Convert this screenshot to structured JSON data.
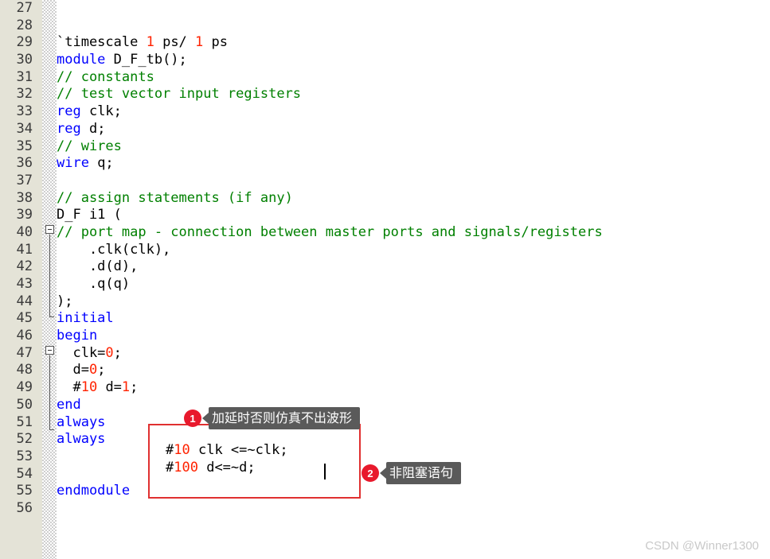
{
  "editor": {
    "first_line_number": 27,
    "language": "verilog",
    "lines": [
      {
        "n": 27,
        "tokens": []
      },
      {
        "n": 28,
        "tokens": []
      },
      {
        "n": 29,
        "tokens": [
          {
            "t": "`timescale ",
            "c": "pl"
          },
          {
            "t": "1",
            "c": "num"
          },
          {
            "t": " ps/ ",
            "c": "pl"
          },
          {
            "t": "1",
            "c": "num"
          },
          {
            "t": " ps",
            "c": "pl"
          }
        ]
      },
      {
        "n": 30,
        "tokens": [
          {
            "t": "module",
            "c": "kw"
          },
          {
            "t": " D_F_tb();",
            "c": "pl"
          }
        ]
      },
      {
        "n": 31,
        "tokens": [
          {
            "t": "// constants",
            "c": "cm"
          }
        ]
      },
      {
        "n": 32,
        "tokens": [
          {
            "t": "// test vector input registers",
            "c": "cm"
          }
        ]
      },
      {
        "n": 33,
        "tokens": [
          {
            "t": "reg",
            "c": "kw"
          },
          {
            "t": " clk;",
            "c": "pl"
          }
        ]
      },
      {
        "n": 34,
        "tokens": [
          {
            "t": "reg",
            "c": "kw"
          },
          {
            "t": " d;",
            "c": "pl"
          }
        ]
      },
      {
        "n": 35,
        "tokens": [
          {
            "t": "// wires",
            "c": "cm"
          }
        ]
      },
      {
        "n": 36,
        "tokens": [
          {
            "t": "wire",
            "c": "kw"
          },
          {
            "t": " q;",
            "c": "pl"
          }
        ]
      },
      {
        "n": 37,
        "tokens": []
      },
      {
        "n": 38,
        "tokens": [
          {
            "t": "// assign statements (if any)",
            "c": "cm"
          }
        ]
      },
      {
        "n": 39,
        "tokens": [
          {
            "t": "D_F i1 (",
            "c": "pl"
          }
        ]
      },
      {
        "n": 40,
        "tokens": [
          {
            "t": "// port map - connection between master ports and signals/registers",
            "c": "cm"
          }
        ]
      },
      {
        "n": 41,
        "tokens": [
          {
            "t": "    .clk(clk),",
            "c": "pl"
          }
        ]
      },
      {
        "n": 42,
        "tokens": [
          {
            "t": "    .d(d),",
            "c": "pl"
          }
        ]
      },
      {
        "n": 43,
        "tokens": [
          {
            "t": "    .q(q)",
            "c": "pl"
          }
        ]
      },
      {
        "n": 44,
        "tokens": [
          {
            "t": ");",
            "c": "pl"
          }
        ]
      },
      {
        "n": 45,
        "tokens": [
          {
            "t": "initial",
            "c": "kw"
          }
        ]
      },
      {
        "n": 46,
        "tokens": [
          {
            "t": "begin",
            "c": "kw"
          }
        ]
      },
      {
        "n": 47,
        "tokens": [
          {
            "t": "  clk=",
            "c": "pl"
          },
          {
            "t": "0",
            "c": "num"
          },
          {
            "t": ";",
            "c": "pl"
          }
        ]
      },
      {
        "n": 48,
        "tokens": [
          {
            "t": "  d=",
            "c": "pl"
          },
          {
            "t": "0",
            "c": "num"
          },
          {
            "t": ";",
            "c": "pl"
          }
        ]
      },
      {
        "n": 49,
        "tokens": [
          {
            "t": "  #",
            "c": "pl"
          },
          {
            "t": "10",
            "c": "num"
          },
          {
            "t": " d=",
            "c": "pl"
          },
          {
            "t": "1",
            "c": "num"
          },
          {
            "t": ";",
            "c": "pl"
          }
        ]
      },
      {
        "n": 50,
        "tokens": [
          {
            "t": "end",
            "c": "kw"
          }
        ]
      },
      {
        "n": 51,
        "tokens": [
          {
            "t": "always",
            "c": "kw"
          }
        ]
      },
      {
        "n": 52,
        "tokens": [
          {
            "t": "always",
            "c": "kw"
          }
        ]
      },
      {
        "n": 53,
        "tokens": []
      },
      {
        "n": 54,
        "tokens": []
      },
      {
        "n": 55,
        "tokens": [
          {
            "t": "endmodule",
            "c": "kw"
          }
        ]
      },
      {
        "n": 56,
        "tokens": []
      }
    ],
    "overlay_lines": [
      {
        "tokens": [
          {
            "t": "#",
            "c": "pl"
          },
          {
            "t": "10",
            "c": "num"
          },
          {
            "t": " clk <=~clk;",
            "c": "pl"
          }
        ]
      },
      {
        "tokens": [
          {
            "t": "#",
            "c": "pl"
          },
          {
            "t": "100",
            "c": "num"
          },
          {
            "t": " d<=~d;",
            "c": "pl"
          }
        ]
      }
    ],
    "fold_markers": [
      {
        "line": 39,
        "label": "fold-collapse-39"
      },
      {
        "line": 46,
        "label": "fold-collapse-46"
      }
    ]
  },
  "annotations": [
    {
      "number": "1",
      "text": "加延时否则仿真不出波形"
    },
    {
      "number": "2",
      "text": "非阻塞语句"
    }
  ],
  "watermark": {
    "text": "CSDN @Winner1300"
  },
  "colors": {
    "keyword": "#0000ff",
    "comment": "#008000",
    "number": "#ff2200",
    "gutter_bg": "#e4e3d7",
    "highlight_box": "#e03030",
    "callout_bg": "#5a5a5a",
    "badge_bg": "#e8192c"
  }
}
